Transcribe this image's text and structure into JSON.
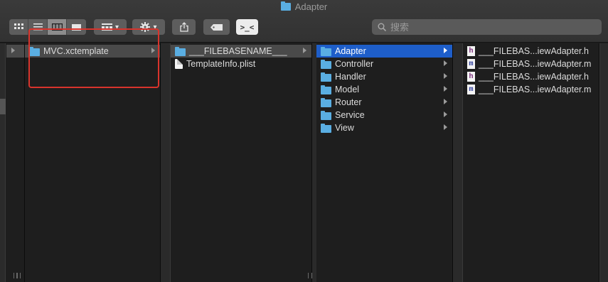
{
  "window": {
    "title": "Adapter"
  },
  "toolbar": {
    "view_icon": "icon-view-icon",
    "view_list": "list-view-icon",
    "view_columns": "columns-view-icon",
    "view_gallery": "gallery-view-icon",
    "group_label": "▾",
    "action_label": "▾",
    "share_icon": "share-icon",
    "tag_icon": "tag-icon",
    "terminal_icon": "terminal-icon",
    "terminal_text": ">_<"
  },
  "search": {
    "placeholder": "搜索"
  },
  "columns": {
    "col1": [
      {
        "name": "MVC.xctemplate",
        "type": "folder",
        "selected": "gray",
        "has_children": true
      }
    ],
    "col2": [
      {
        "name": "___FILEBASENAME___",
        "type": "folder",
        "selected": "gray",
        "has_children": true
      },
      {
        "name": "TemplateInfo.plist",
        "type": "doc"
      }
    ],
    "col3": [
      {
        "name": "Adapter",
        "type": "folder",
        "selected": "blue",
        "has_children": true
      },
      {
        "name": "Controller",
        "type": "folder",
        "has_children": true
      },
      {
        "name": "Handler",
        "type": "folder",
        "has_children": true
      },
      {
        "name": "Model",
        "type": "folder",
        "has_children": true
      },
      {
        "name": "Router",
        "type": "folder",
        "has_children": true
      },
      {
        "name": "Service",
        "type": "folder",
        "has_children": true
      },
      {
        "name": "View",
        "type": "folder",
        "has_children": true
      }
    ],
    "col4": [
      {
        "name": "___FILEBAS...iewAdapter.h",
        "type": "h"
      },
      {
        "name": "___FILEBAS...iewAdapter.m",
        "type": "m"
      },
      {
        "name": "___FILEBAS...iewAdapter.h",
        "type": "h"
      },
      {
        "name": "___FILEBAS...iewAdapter.m",
        "type": "m"
      }
    ]
  },
  "colors": {
    "selection_blue": "#1e5ec9",
    "folder_blue": "#5aaee2",
    "annotation_red": "#d8342c"
  }
}
